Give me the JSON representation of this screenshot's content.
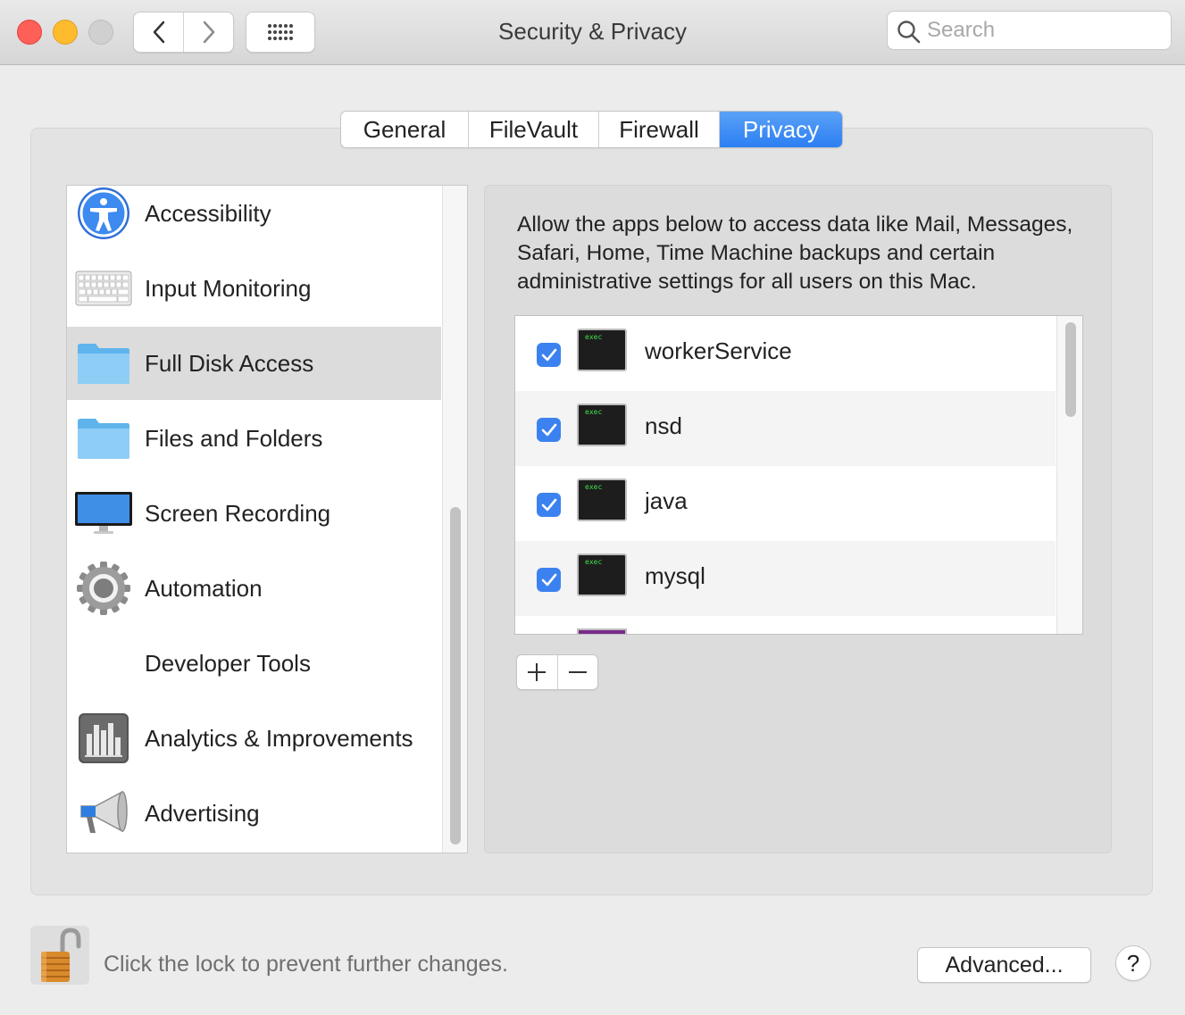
{
  "window": {
    "title": "Security & Privacy",
    "search_placeholder": "Search"
  },
  "tabs": [
    {
      "label": "General",
      "active": false
    },
    {
      "label": "FileVault",
      "active": false
    },
    {
      "label": "Firewall",
      "active": false
    },
    {
      "label": "Privacy",
      "active": true
    }
  ],
  "categories": [
    {
      "label": "Accessibility",
      "icon": "accessibility-icon"
    },
    {
      "label": "Input Monitoring",
      "icon": "keyboard-icon"
    },
    {
      "label": "Full Disk Access",
      "icon": "folder-icon",
      "selected": true
    },
    {
      "label": "Files and Folders",
      "icon": "folder-icon"
    },
    {
      "label": "Screen Recording",
      "icon": "monitor-icon"
    },
    {
      "label": "Automation",
      "icon": "gear-icon"
    },
    {
      "label": "Developer Tools",
      "icon": ""
    },
    {
      "label": "Analytics & Improvements",
      "icon": "bar-chart-icon"
    },
    {
      "label": "Advertising",
      "icon": "megaphone-icon"
    }
  ],
  "privacy": {
    "description": "Allow the apps below to access data like Mail, Messages, Safari, Home, Time Machine backups and certain administrative settings for all users on this Mac.",
    "apps": [
      {
        "name": "workerService",
        "checked": true,
        "icon_label": "exec"
      },
      {
        "name": "nsd",
        "checked": true,
        "icon_label": "exec"
      },
      {
        "name": "java",
        "checked": true,
        "icon_label": "exec"
      },
      {
        "name": "mysql",
        "checked": true,
        "icon_label": "exec"
      }
    ],
    "add_label": "+",
    "remove_label": "—"
  },
  "footer": {
    "lock_text": "Click the lock to prevent further changes.",
    "advanced_label": "Advanced...",
    "help_label": "?"
  },
  "colors": {
    "accent": "#2c7ff3",
    "close": "#fe5f57",
    "minimize": "#febb2e",
    "zoom_disabled": "#d0d0d0"
  }
}
